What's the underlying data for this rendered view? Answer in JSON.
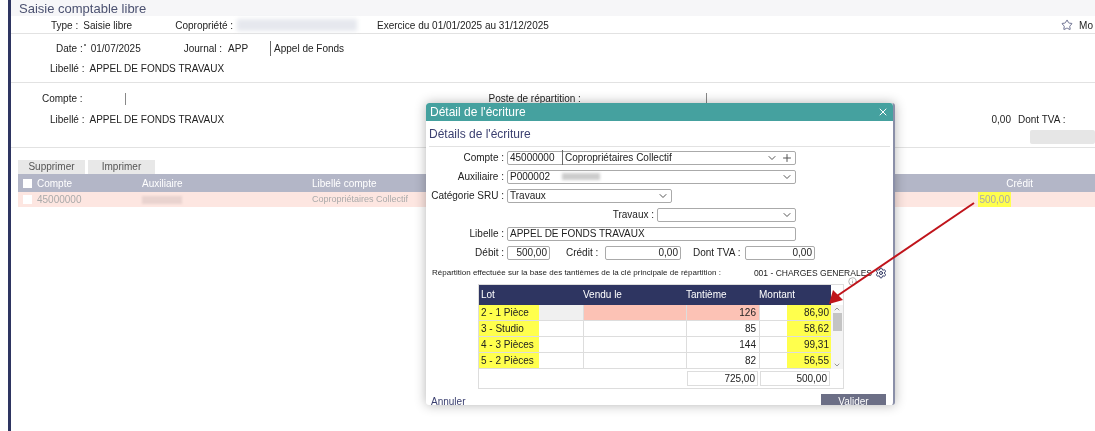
{
  "page": {
    "title": "Saisie comptable libre",
    "favorite_label": "Mo"
  },
  "header": {
    "type_label": "Type :",
    "type_value": "Saisie libre",
    "copro_label": "Copropriété :",
    "exercice": "Exercice du 01/01/2025 au 31/12/2025",
    "date_label": "Date :",
    "date_required": true,
    "date_value": "01/07/2025",
    "journal_label": "Journal :",
    "journal_code": "APP",
    "journal_name": "Appel de Fonds",
    "libelle_label": "Libellé :",
    "libelle_value": "APPEL DE FONDS TRAVAUX"
  },
  "line": {
    "compte_label": "Compte :",
    "libelle_label": "Libellé :",
    "libelle_value": "APPEL DE FONDS TRAVAUX",
    "poste_label": "Poste de répartition :",
    "amount": "0,00",
    "tva_label": "Dont TVA :"
  },
  "buttons": [
    "Supprimer",
    "Imprimer"
  ],
  "table": {
    "select_all_checked": false,
    "columns": [
      "Compte",
      "Auxiliaire",
      "Libellé compte",
      "Crédit"
    ],
    "rows": [
      {
        "checked": false,
        "selected": true,
        "compte": "45000000",
        "libelle": "Copropriétaires Collectif",
        "credit": "500,00",
        "credit_highlighted": true
      }
    ]
  },
  "dialog": {
    "title": "Détail de l'écriture",
    "subtitle": "Détails de l'écriture",
    "compte_label": "Compte :",
    "compte_code": "45000000",
    "compte_name": "Copropriétaires Collectif",
    "auxiliaire_label": "Auxiliaire :",
    "auxiliaire_code": "P000002",
    "categorie_label": "Catégorie SRU :",
    "categorie_value": "Travaux",
    "travaux_label": "Travaux :",
    "libelle_label": "Libelle :",
    "libelle_value": "APPEL DE FONDS TRAVAUX",
    "debit_label": "Débit :",
    "debit_value": "500,00",
    "credit_label": "Crédit :",
    "credit_value": "0,00",
    "tva_label": "Dont TVA :",
    "tva_value": "0,00",
    "repartition_text": "Répartition effectuée sur la base des tantièmes de la clé principale de répartition :",
    "repartition_key": "001 - CHARGES GENERALES",
    "columns": [
      "Lot",
      "Vendu le",
      "Tantième",
      "Montant"
    ],
    "rows": [
      {
        "lot": "2 - 1 Pièce",
        "tantieme": "126",
        "montant": "86,90",
        "selected": true,
        "highlighted": true
      },
      {
        "lot": "3 - Studio",
        "tantieme": "85",
        "montant": "58,62",
        "selected": false,
        "highlighted": true
      },
      {
        "lot": "4 - 3 Pièces",
        "tantieme": "144",
        "montant": "99,31",
        "selected": false,
        "highlighted": true
      },
      {
        "lot": "5 - 2 Pièces",
        "tantieme": "82",
        "montant": "56,55",
        "selected": false,
        "highlighted": true
      }
    ],
    "total_tantieme": "725,00",
    "total_montant": "500,00",
    "cancel": "Annuler",
    "validate": "Valider"
  }
}
